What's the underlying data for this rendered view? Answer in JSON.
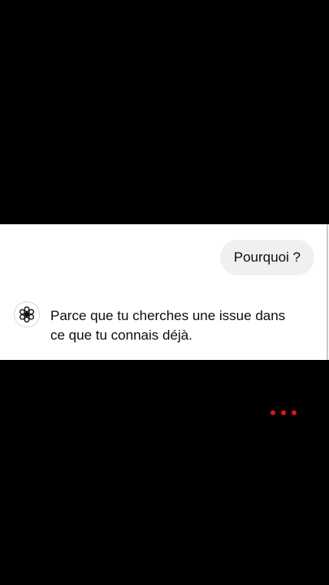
{
  "chat": {
    "user_message": "Pourquoi ?",
    "assistant_message": "Parce que tu cherches une issue dans ce que tu connais déjà.",
    "assistant_avatar_icon": "openai-logo-icon"
  },
  "indicator": {
    "icon": "more-dots-icon",
    "color": "#e3101d"
  },
  "colors": {
    "background": "#000000",
    "panel": "#ffffff",
    "user_bubble": "#f0f0f0",
    "text": "#0d0d0d"
  }
}
